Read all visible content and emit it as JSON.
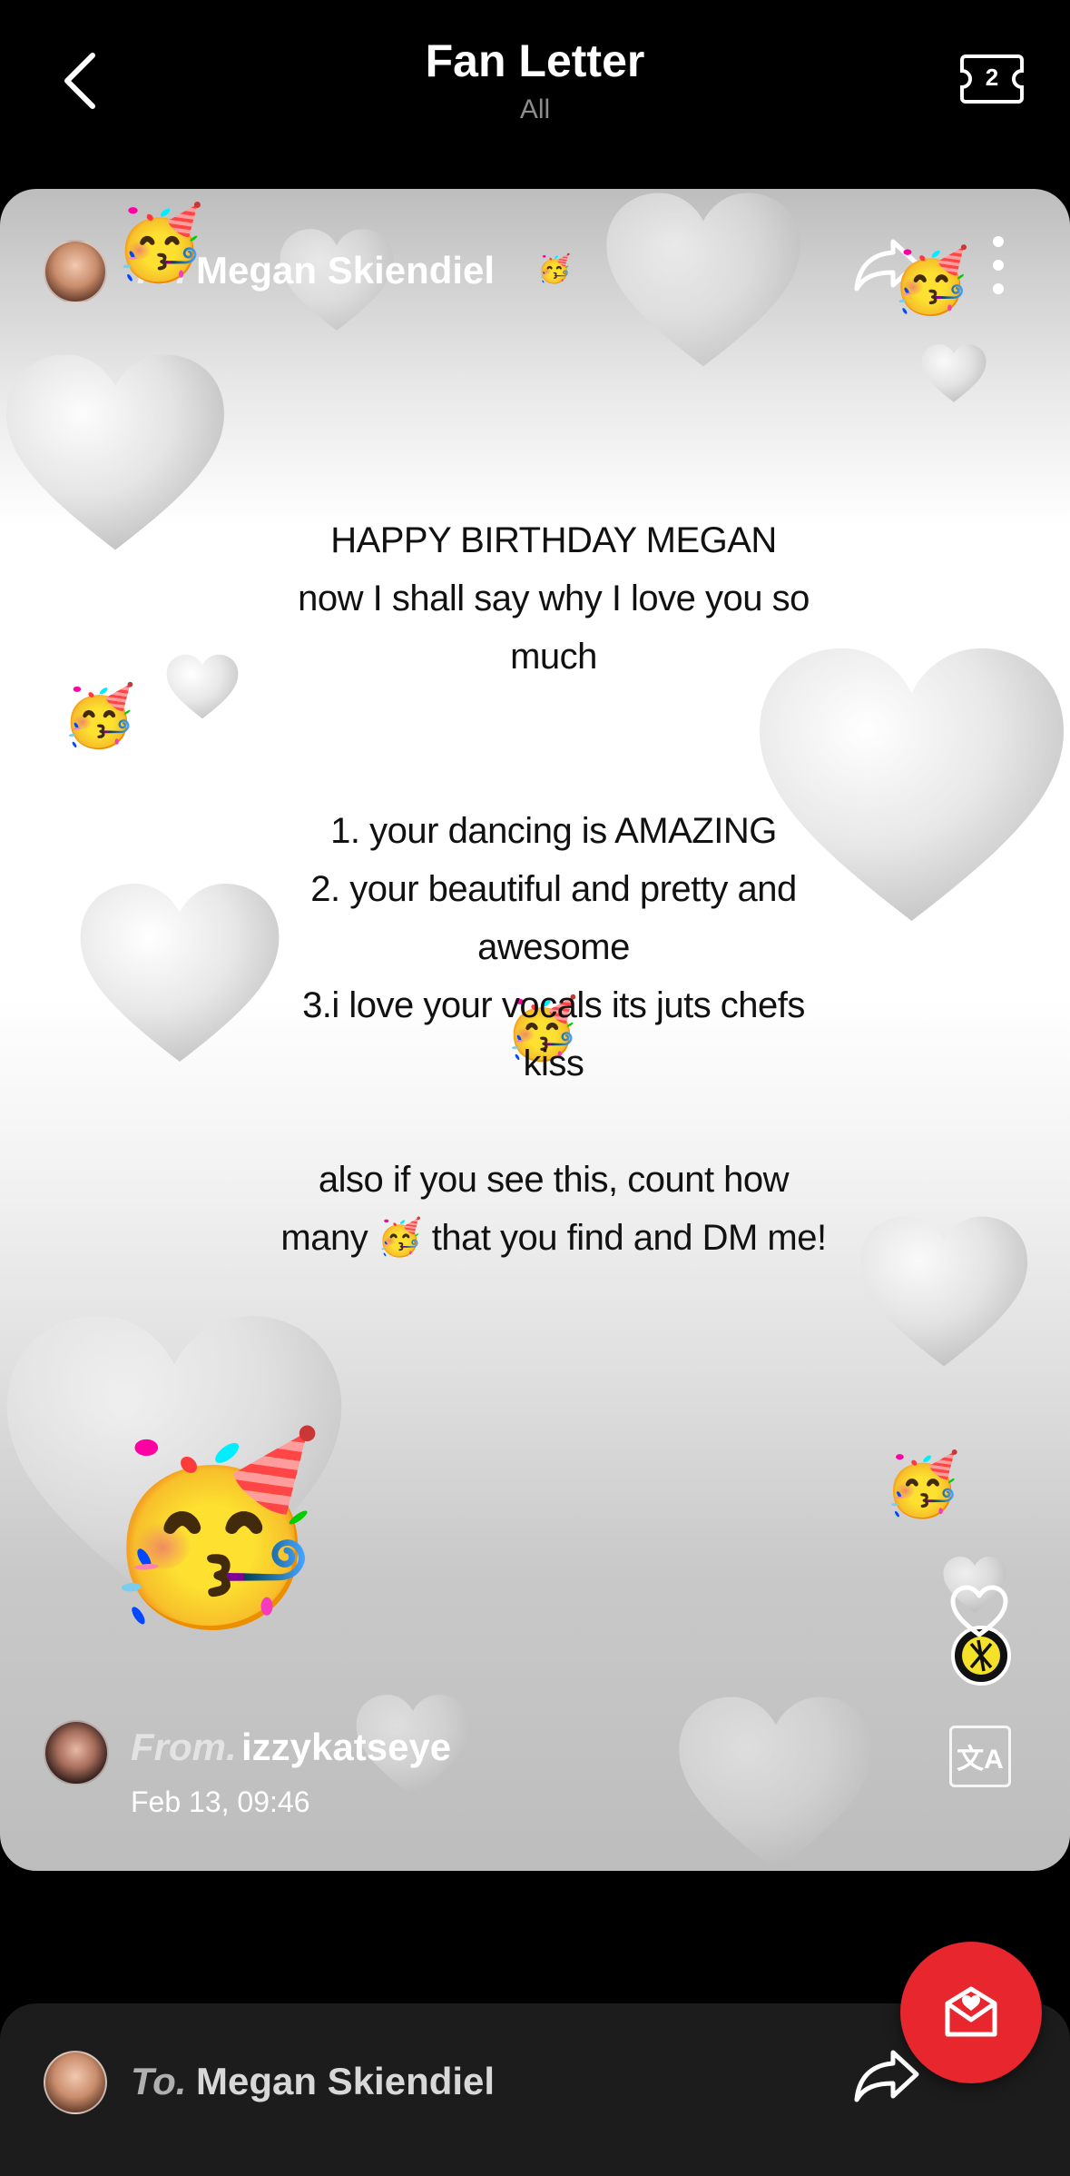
{
  "header": {
    "title": "Fan Letter",
    "subtitle": "All",
    "ticket_count": "2"
  },
  "letter_card": {
    "to_label": "To.",
    "to_name": "Megan Skiendiel",
    "body_lines": [
      "HAPPY BIRTHDAY MEGAN",
      "now I shall say why I love you so",
      "much",
      "",
      "",
      "1. your dancing is AMAZING",
      "2. your beautiful and pretty and",
      "awesome",
      "3.i love your vocals its juts chefs",
      "kiss",
      "",
      "also if you see this, count how",
      "many 🥳 that you find and DM me!"
    ],
    "from_label": "From.",
    "from_name": "izzykatseye",
    "date": "Feb 13, 09:46",
    "translate_glyph": "文A",
    "emoji": "🥳"
  },
  "next_card": {
    "to_label": "To.",
    "to_name": "Megan Skiendiel"
  },
  "colors": {
    "background": "#000000",
    "fab": "#e8262d",
    "next_card": "#1c1c1c"
  },
  "icons": [
    "back-chevron-icon",
    "ticket-icon",
    "share-arrow-icon",
    "more-vertical-icon",
    "heart-icon",
    "translate-icon",
    "letter-heart-icon"
  ]
}
